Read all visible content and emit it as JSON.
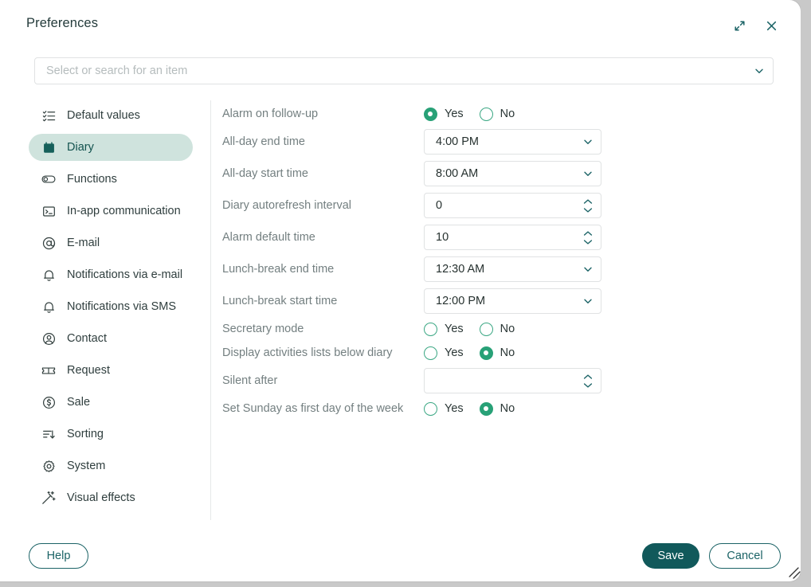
{
  "window": {
    "title": "Preferences",
    "expand_icon": "expand-arrows-icon",
    "close_icon": "close-icon"
  },
  "search": {
    "placeholder": "Select or search for an item",
    "value": "",
    "chevron_icon": "chevron-down-icon"
  },
  "sidebar": {
    "items": [
      {
        "label": "Default values",
        "icon": "checklist-icon",
        "active": false
      },
      {
        "label": "Diary",
        "icon": "calendar-icon",
        "active": true
      },
      {
        "label": "Functions",
        "icon": "toggle-icon",
        "active": false
      },
      {
        "label": "In-app communication",
        "icon": "terminal-icon",
        "active": false
      },
      {
        "label": "E-mail",
        "icon": "at-sign-icon",
        "active": false
      },
      {
        "label": "Notifications via e-mail",
        "icon": "bell-icon",
        "active": false
      },
      {
        "label": "Notifications via SMS",
        "icon": "bell-icon",
        "active": false
      },
      {
        "label": "Contact",
        "icon": "user-circle-icon",
        "active": false
      },
      {
        "label": "Request",
        "icon": "ticket-icon",
        "active": false
      },
      {
        "label": "Sale",
        "icon": "dollar-circle-icon",
        "active": false
      },
      {
        "label": "Sorting",
        "icon": "sort-desc-icon",
        "active": false
      },
      {
        "label": "System",
        "icon": "gear-icon",
        "active": false
      },
      {
        "label": "Visual effects",
        "icon": "magic-wand-icon",
        "active": false
      }
    ]
  },
  "form": {
    "rows": [
      {
        "label": "Alarm on follow-up",
        "type": "radio",
        "options": [
          {
            "label": "Yes",
            "selected": true
          },
          {
            "label": "No",
            "selected": false
          }
        ]
      },
      {
        "label": "All-day end time",
        "type": "select",
        "value": "4:00 PM",
        "affix_icon": "chevron-down-icon"
      },
      {
        "label": "All-day start time",
        "type": "select",
        "value": "8:00 AM",
        "affix_icon": "chevron-down-icon"
      },
      {
        "label": "Diary autorefresh interval",
        "type": "spinner",
        "value": "0",
        "affix_icon": "spinner-arrows-icon"
      },
      {
        "label": "Alarm default time",
        "type": "spinner",
        "value": "10",
        "affix_icon": "spinner-arrows-icon"
      },
      {
        "label": "Lunch-break end time",
        "type": "select",
        "value": "12:30 AM",
        "affix_icon": "chevron-down-icon"
      },
      {
        "label": "Lunch-break start time",
        "type": "select",
        "value": "12:00 PM",
        "affix_icon": "chevron-down-icon"
      },
      {
        "label": "Secretary mode",
        "type": "radio",
        "options": [
          {
            "label": "Yes",
            "selected": false
          },
          {
            "label": "No",
            "selected": false
          }
        ]
      },
      {
        "label": "Display activities lists below diary",
        "type": "radio",
        "options": [
          {
            "label": "Yes",
            "selected": false
          },
          {
            "label": "No",
            "selected": true
          }
        ]
      },
      {
        "label": "Silent after",
        "type": "spinner",
        "value": "",
        "affix_icon": "spinner-arrows-icon"
      },
      {
        "label": "Set Sunday as first day of the week",
        "type": "radio",
        "options": [
          {
            "label": "Yes",
            "selected": false
          },
          {
            "label": "No",
            "selected": true
          }
        ]
      }
    ]
  },
  "footer": {
    "help_label": "Help",
    "save_label": "Save",
    "cancel_label": "Cancel"
  },
  "colors": {
    "accent_dark": "#11595b",
    "accent_teal": "#1b6366",
    "radio_green": "#28a177",
    "active_bg": "#cfe3dd",
    "label_gray": "#737f80",
    "border_gray": "#e0e2e3"
  }
}
